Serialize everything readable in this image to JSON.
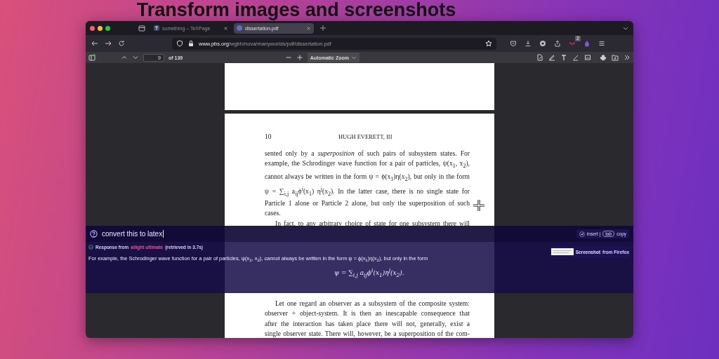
{
  "headline": "Transform images and screenshots",
  "browser": {
    "tabs": [
      {
        "title": "something – TeXPage",
        "selected": false
      },
      {
        "title": "dissertation.pdf",
        "selected": true
      }
    ],
    "url_domain": "www.pbs.org",
    "url_path": "/wgbh/nova/manyworlds/pdf/dissertation.pdf",
    "extension_badge": "2"
  },
  "pdf_toolbar": {
    "page": "9",
    "page_count": "of 139",
    "zoom": "Automatic Zoom"
  },
  "document": {
    "page_number": "10",
    "running_head": "HUGH EVERETT, III",
    "lines": [
      {
        "kind": "line",
        "text": "sented only by a *superposition* of such pairs of subsystem states.  For"
      },
      {
        "kind": "line",
        "text": "example, the Schrodinger wave function for a pair of particles,  ψ(x$_{1}$, x$_{2}$),"
      },
      {
        "kind": "line",
        "text": "cannot always be written in the form  ψ = ϕ(x$_{1}$)η(x$_{2}$),  but only in the form"
      },
      {
        "kind": "formula",
        "text": "ψ = ∑$_{i,j}$ a$_{ij}$ϕ$^{i}$(x$_{1}$) η$^{j}$(x$_{2}$).  In the latter case, there is no single state for"
      },
      {
        "kind": "line",
        "text": "Particle 1 alone or Particle 2 alone, but only the superposition of such"
      },
      {
        "kind": "end",
        "text": "cases."
      },
      {
        "kind": "indent",
        "text": "In fact, to any arbitrary choice of state for one subsystem there will"
      }
    ],
    "lines_below": [
      {
        "kind": "indent",
        "text": "Let one regard an observer as a subsystem of the composite system:"
      },
      {
        "kind": "line",
        "text": "observer + object-system.  It is then an inescapable consequence that"
      },
      {
        "kind": "line",
        "text": "after the interaction has taken place there will not, generally, exist a"
      },
      {
        "kind": "line",
        "text": "single observer state.  There will, however, be a superposition of the com-"
      }
    ]
  },
  "assistant": {
    "query": "convert this to latex",
    "insert_label": "insert |",
    "copy_key": "tab",
    "copy_label": "copy",
    "response_prefix": "Response from",
    "response_model": "ailight ultimate",
    "response_suffix": "(retrieved in 3.7s)",
    "response_text": "For example, the Schrodinger wave function for a pair of particles, ψ(x$_{1}$, x$_{2}$), cannot always be written in the form ψ = ϕ(x$_{1}$)η(x$_{2}$), but only in the form",
    "equation": "ψ = ∑$_{i,j}$ a$_{ij}$ϕ$^{i}$(x$_{1}$)η$^{j}$(x$_{2}$).",
    "source_name": "Screenshot",
    "source_from": "from Firefox"
  }
}
